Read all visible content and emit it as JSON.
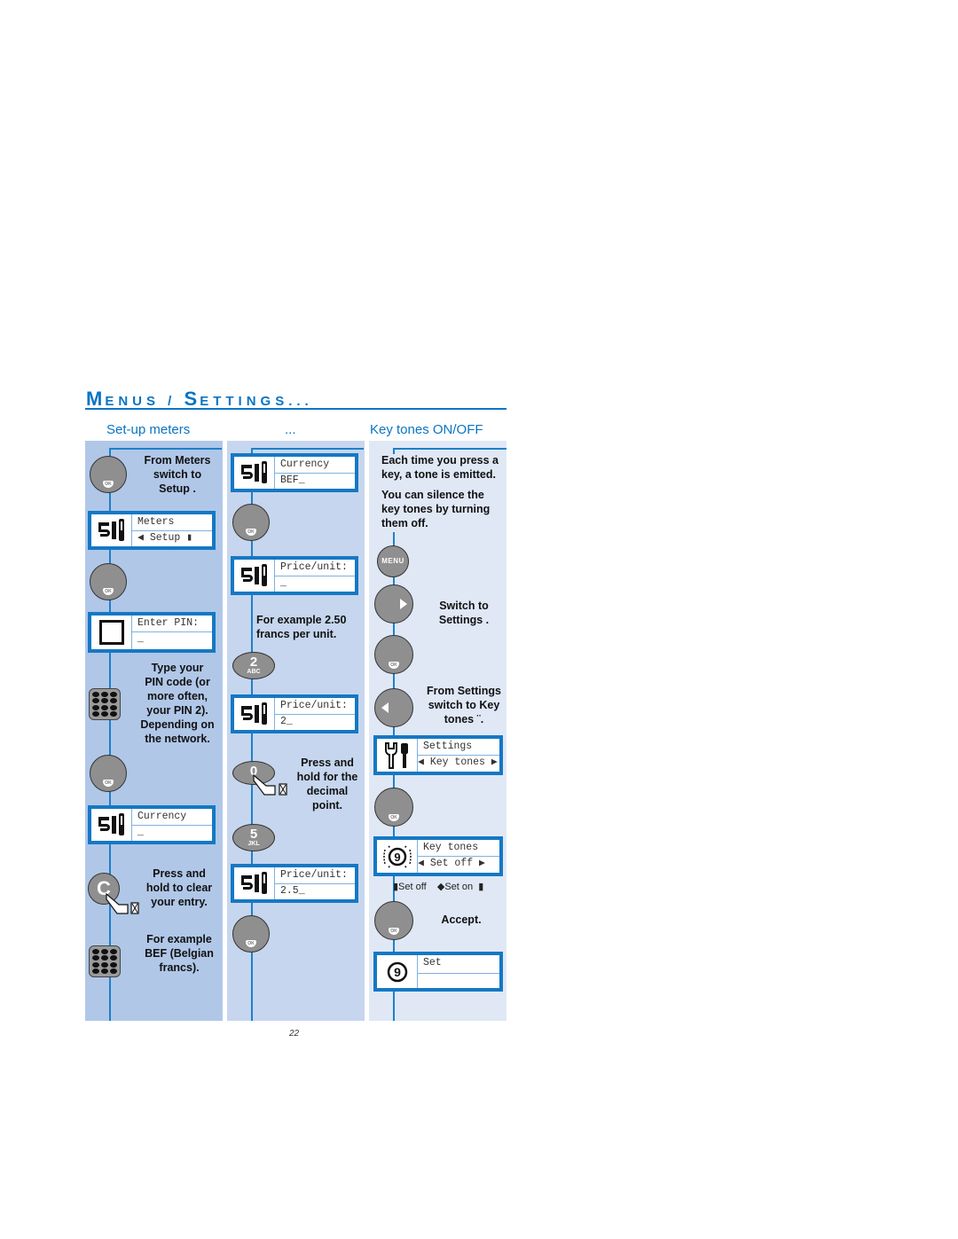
{
  "header": {
    "title_cap1": "M",
    "title_rest1": "ENUS",
    "title_sep": " / ",
    "title_cap2": "S",
    "title_rest2": "ETTINGS...",
    "columns": [
      "Set-up meters",
      "...",
      "Key tones ON/OFF"
    ]
  },
  "col1": {
    "step1_text": [
      "From Meters",
      "switch to",
      "Setup ."
    ],
    "screen1": {
      "line1": "Meters",
      "line2": "◀  Setup    ▮",
      "icon": "meter-icon"
    },
    "screen2": {
      "line1": "Enter PIN:",
      "line2": "_",
      "icon": "blank-square-icon"
    },
    "step3_text": [
      "Type your",
      "PIN code (or",
      "more often,",
      "your PIN 2).",
      "Depending on",
      "the network."
    ],
    "screen3": {
      "line1": "Currency",
      "line2": "_",
      "icon": "meter-icon"
    },
    "step5_text": [
      "Press and",
      "hold to clear",
      "your entry."
    ],
    "step6_text": [
      "For example",
      "BEF (Belgian",
      "francs)."
    ],
    "clear_key_label": "C"
  },
  "col2": {
    "screen1": {
      "line1": "Currency",
      "line2": "BEF_",
      "icon": "meter-icon"
    },
    "screen2": {
      "line1": "Price/unit:",
      "line2": "_",
      "icon": "meter-icon"
    },
    "example_text": [
      "For example 2.50",
      "francs per unit."
    ],
    "key2": {
      "num": "2",
      "letters": "ABC"
    },
    "screen3": {
      "line1": "Price/unit:",
      "line2": "2_",
      "icon": "meter-icon"
    },
    "key0": {
      "num": "0"
    },
    "decimal_text": [
      "Press and",
      "hold for the",
      "decimal",
      "point."
    ],
    "key5": {
      "num": "5",
      "letters": "JKL"
    },
    "screen4": {
      "line1": "Price/unit:",
      "line2": "2.5_",
      "icon": "meter-icon"
    }
  },
  "col3": {
    "intro1": [
      "Each time you press a",
      "key, a tone is emitted."
    ],
    "intro2": [
      "You can silence the",
      "key tones by turning",
      "them off."
    ],
    "menu_label": "MENU",
    "switch_text": [
      "Switch to",
      "Settings ."
    ],
    "from_settings_text": [
      "From Settings",
      "switch to  Key",
      "tones ¨."
    ],
    "screen1": {
      "line1": "Settings",
      "line2": "◀ Key tones ▶",
      "icon": "settings-tools-icon"
    },
    "screen2": {
      "line1": "Key tones",
      "line2": "◀  Set off   ▶",
      "icon": "ringing-9-icon"
    },
    "options_text": "▮Set off    ◆Set on  ▮",
    "accept_text": "Accept.",
    "screen3": {
      "line1": "Set",
      "line2": "",
      "icon": "9-icon"
    }
  },
  "ok_label": "OK",
  "page_number": "22",
  "colors": {
    "accent": "#0a74c4",
    "panel1": "#b0c7e8",
    "panel2": "#c6d6ee",
    "panel3": "#e0e8f6"
  }
}
